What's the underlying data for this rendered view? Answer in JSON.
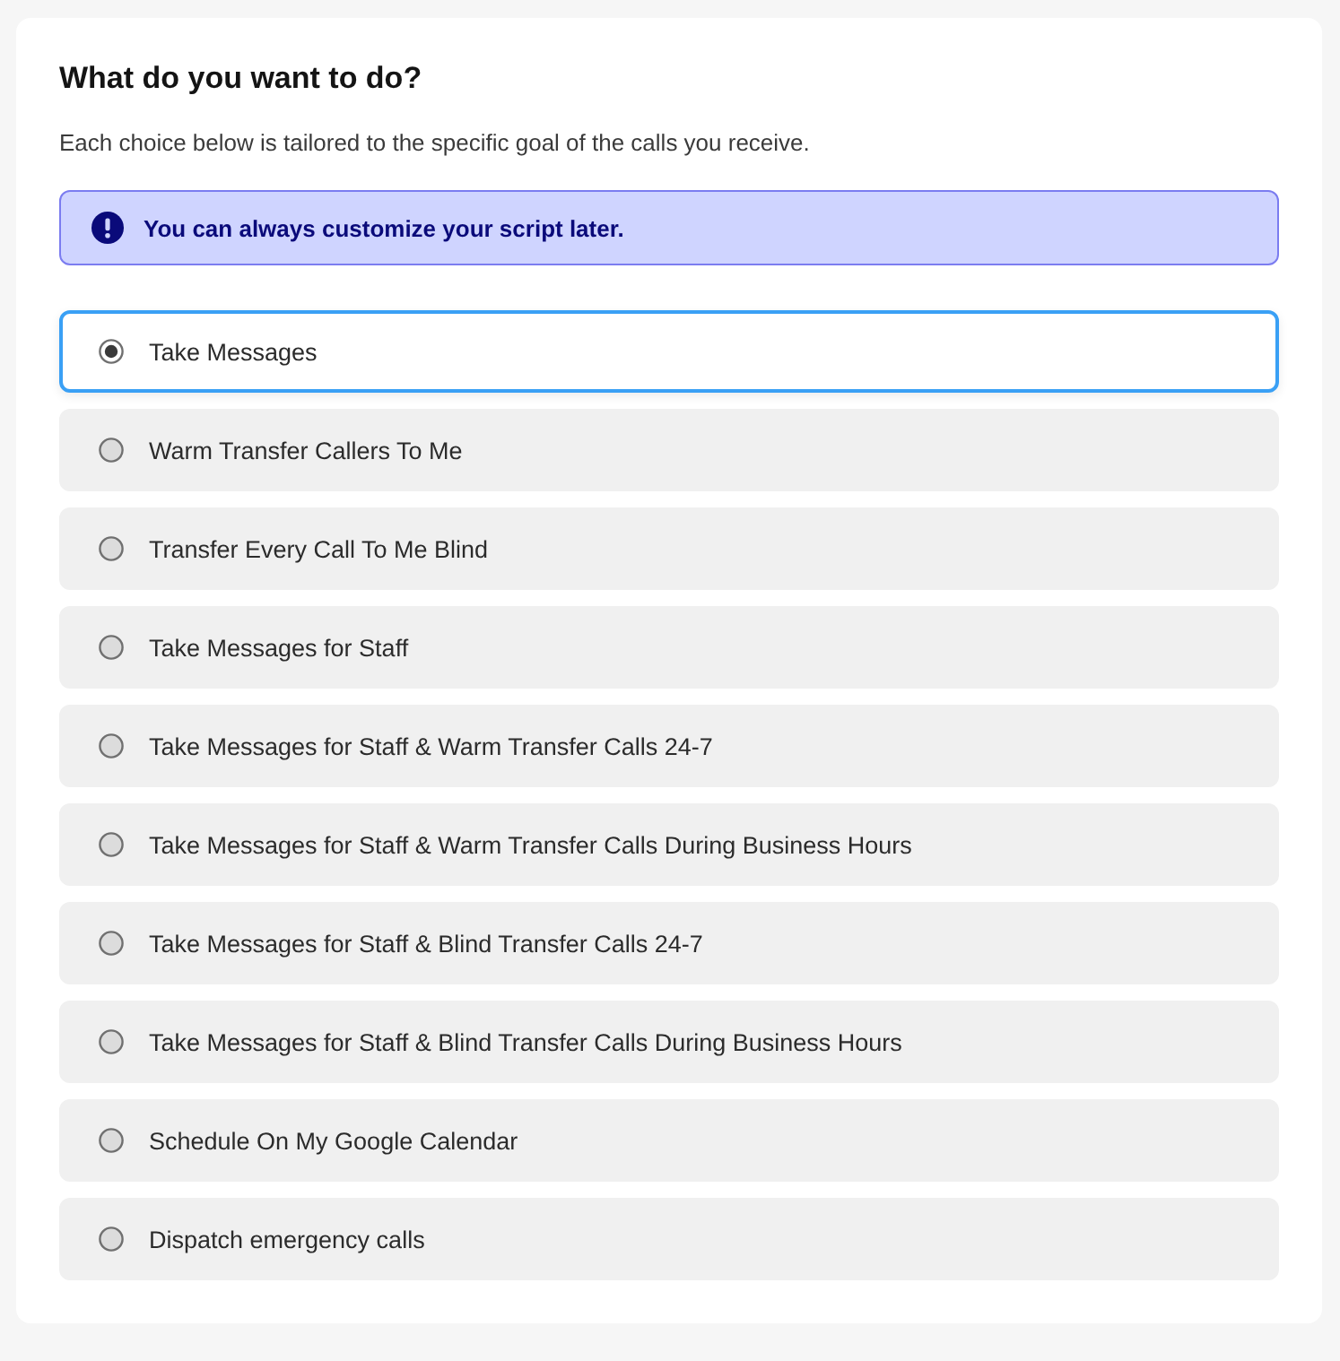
{
  "title": "What do you want to do?",
  "subtitle": "Each choice below is tailored to the specific goal of the calls you receive.",
  "notice": {
    "text": "You can always customize your script later."
  },
  "options": [
    {
      "label": "Take Messages",
      "selected": true
    },
    {
      "label": "Warm Transfer Callers To Me",
      "selected": false
    },
    {
      "label": "Transfer Every Call To Me Blind",
      "selected": false
    },
    {
      "label": "Take Messages for Staff",
      "selected": false
    },
    {
      "label": "Take Messages for Staff & Warm Transfer Calls 24-7",
      "selected": false
    },
    {
      "label": "Take Messages for Staff & Warm Transfer Calls During Business Hours",
      "selected": false
    },
    {
      "label": "Take Messages for Staff & Blind Transfer Calls 24-7",
      "selected": false
    },
    {
      "label": "Take Messages for Staff & Blind Transfer Calls During Business Hours",
      "selected": false
    },
    {
      "label": "Schedule On My Google Calendar",
      "selected": false
    },
    {
      "label": "Dispatch emergency calls",
      "selected": false
    }
  ]
}
